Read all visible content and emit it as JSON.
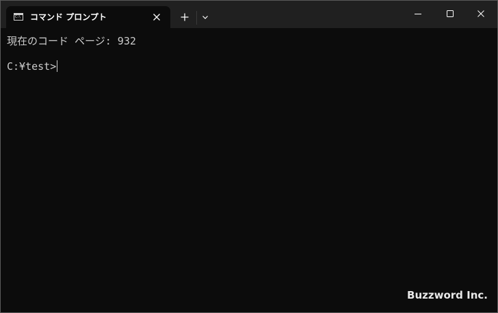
{
  "window": {
    "tab_title": "コマンド プロンプト",
    "tab_icon_glyph": "C:\\",
    "icons": {
      "tab": "command-prompt-icon",
      "tab_close": "close-icon",
      "new_tab": "plus-icon",
      "dropdown": "chevron-down-icon",
      "minimize": "minimize-icon",
      "maximize": "maximize-icon",
      "close": "close-icon"
    }
  },
  "terminal": {
    "line1": "現在のコード ページ: 932",
    "prompt": "C:¥test>"
  },
  "watermark": "Buzzword Inc.",
  "colors": {
    "titlebar": "#202020",
    "background": "#0c0c0c",
    "text": "#cccccc"
  }
}
